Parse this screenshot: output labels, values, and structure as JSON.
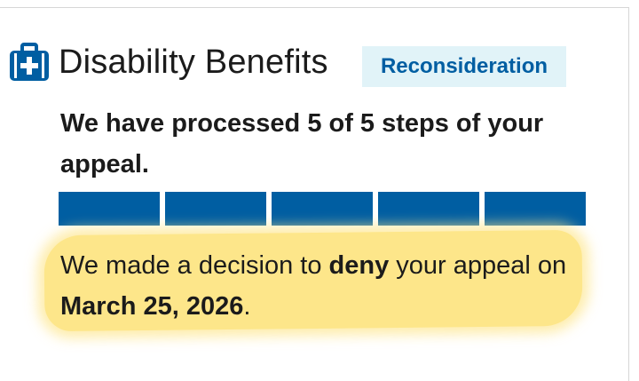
{
  "header": {
    "title": "Disability Benefits",
    "badge": "Reconsideration",
    "icon": "medical-briefcase-icon"
  },
  "progress": {
    "text": "We have processed 5 of 5 steps of your appeal.",
    "completed_steps": 5,
    "total_steps": 5,
    "segment_color": "#005ea2"
  },
  "decision": {
    "prefix": "We made a decision to ",
    "outcome": "deny",
    "middle": " your appeal on ",
    "date": "March 25, 2026",
    "suffix": ".",
    "highlight_color": "#fde68a"
  },
  "colors": {
    "badge_bg": "#e1f3f8",
    "badge_text": "#005ea2",
    "icon": "#005ea2"
  }
}
